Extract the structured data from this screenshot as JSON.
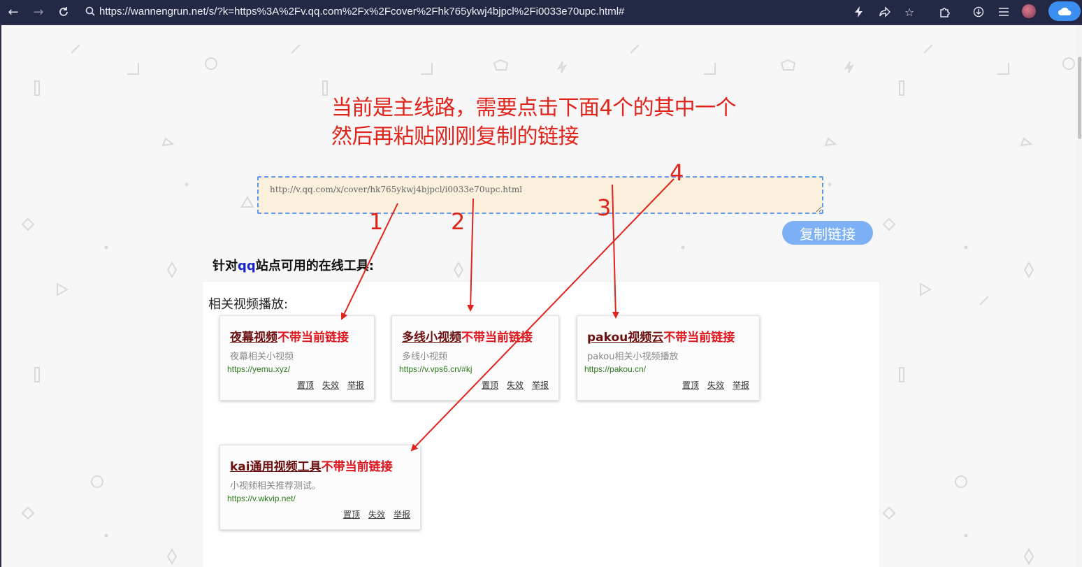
{
  "browser": {
    "url": "https://wannengrun.net/s/?k=https%3A%2Fv.qq.com%2Fx%2Fcover%2Fhk765ykwj4bjpcl%2Fi0033e70upc.html#"
  },
  "page": {
    "headline_line1": "当前是主线路，需要点击下面4个的其中一个",
    "headline_line2": "然后再粘贴刚刚复制的链接",
    "link_value": "http://v.qq.com/x/cover/hk765ykwj4bjpcl/i0033e70upc.html",
    "copy_button": "复制链接",
    "section_title_prefix": "针对",
    "section_title_site": "qq",
    "section_title_suffix": "站点可用的在线工具:",
    "panel_title": "相关视频播放:"
  },
  "cards": [
    {
      "name": "夜幕视频",
      "tag": "不带当前链接",
      "desc": "夜幕相关小视频",
      "url": "https://yemu.xyz/"
    },
    {
      "name": "多线小视频",
      "tag": "不带当前链接",
      "desc": "多线小视频",
      "url": "https://v.vps6.cn/#kj"
    },
    {
      "name": "pakou视频云",
      "tag": "不带当前链接",
      "desc": "pakou相关小视频播放",
      "url": "https://pakou.cn/"
    },
    {
      "name": "kai通用视频工具",
      "tag": "不带当前链接",
      "desc": "小视频相关推荐测试。",
      "url": "https://v.wkvip.net/"
    }
  ],
  "card_actions": {
    "pin": "置顶",
    "invalid": "失效",
    "report": "举报"
  },
  "annotations": [
    "1",
    "2",
    "3",
    "4"
  ],
  "colors": {
    "accent_red": "#e0241c",
    "card_name": "#6b0f0f",
    "url_green": "#2a7a1a",
    "copy_button": "#7db0f5"
  }
}
